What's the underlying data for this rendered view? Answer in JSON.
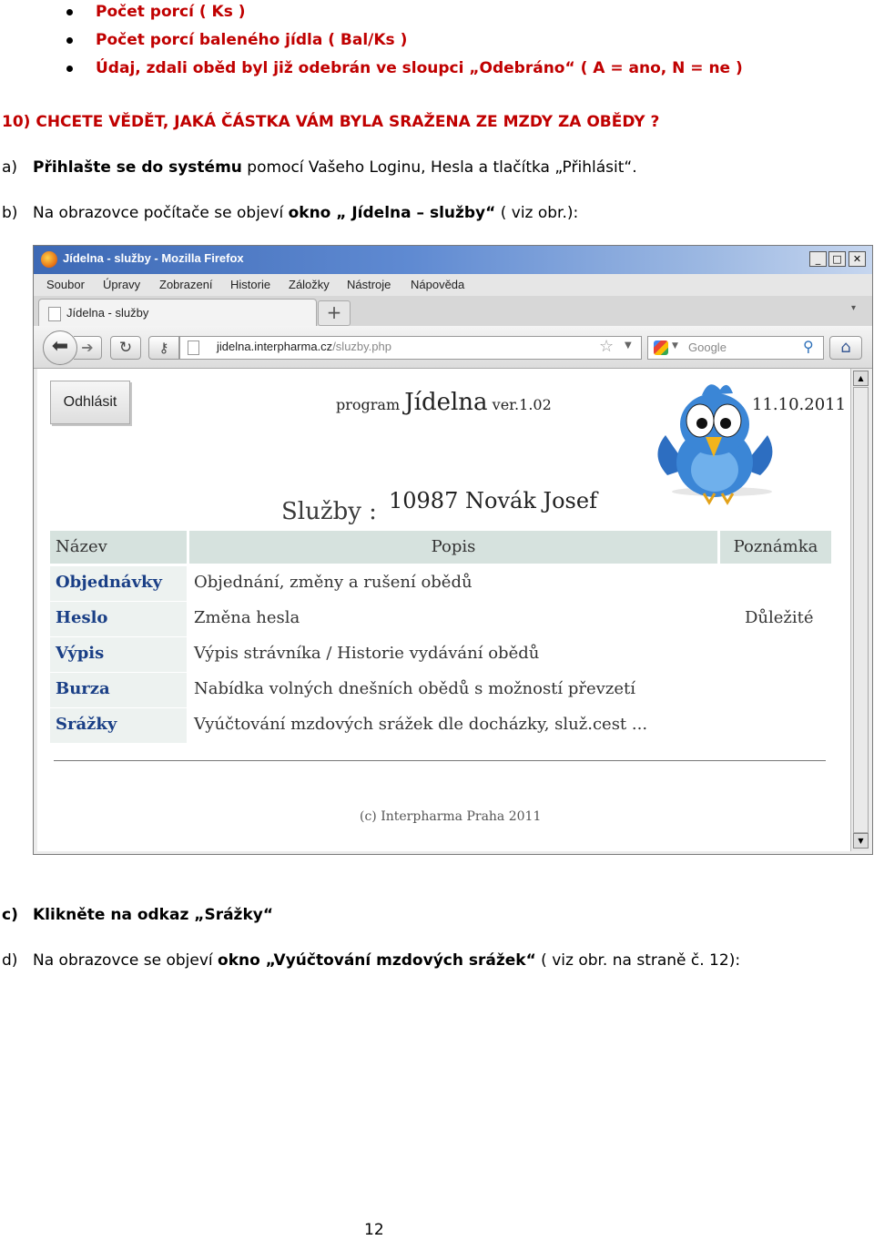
{
  "bullets": [
    "Počet porcí ( Ks )",
    "Počet porcí baleného jídla ( Bal/Ks )",
    "Údaj, zdali oběd byl již odebrán ve sloupci „Odebráno“  ( A = ano, N = ne )"
  ],
  "heading": "10) CHCETE VĚDĚT, JAKÁ ČÁSTKA VÁM BYLA SRAŽENA ZE MZDY ZA OBĚDY ?",
  "para_a": {
    "label": "a)",
    "bold": "Přihlašte se do systému",
    "rest": " pomocí Vašeho Loginu, Hesla a tlačítka „Přihlásit“."
  },
  "para_b": {
    "label": "b)",
    "pre": "Na obrazovce počítače se objeví ",
    "bold": "okno „ Jídelna – služby“",
    "rest": " ( viz obr.):"
  },
  "browser": {
    "title": "Jídelna - služby - Mozilla Firefox",
    "menu": [
      "Soubor",
      "Úpravy",
      "Zobrazení",
      "Historie",
      "Záložky",
      "Nástroje",
      "Nápověda"
    ],
    "tab_title": "Jídelna - služby",
    "url_domain": "jidelna.interpharma.cz",
    "url_path": "/sluzby.php",
    "search_placeholder": "Google",
    "page": {
      "logout": "Odhlásit",
      "program_prefix": "program",
      "program_name": "Jídelna",
      "program_version": "ver.1.02",
      "date": "11.10.2011",
      "services_label": "Služby :",
      "user_id": "10987",
      "user_name": "Novák Josef",
      "columns": [
        "Název",
        "Popis",
        "Poznámka"
      ],
      "rows": [
        {
          "name": "Objednávky",
          "desc": "Objednání, změny a rušení obědů",
          "note": ""
        },
        {
          "name": "Heslo",
          "desc": "Změna hesla",
          "note": "Důležité"
        },
        {
          "name": "Výpis",
          "desc": "Výpis strávníka / Historie vydávání obědů",
          "note": ""
        },
        {
          "name": "Burza",
          "desc": "Nabídka volných dnešních obědů s možností převzetí",
          "note": ""
        },
        {
          "name": "Srážky",
          "desc": "Vyúčtování mzdových srážek dle docházky, služ.cest ...",
          "note": ""
        }
      ],
      "footer": "(c) Interpharma Praha 2011"
    }
  },
  "para_c": {
    "label": "c)",
    "bold": "Klikněte na odkaz „Srážky“"
  },
  "para_d": {
    "label": "d)",
    "pre": "Na obrazovce se objeví ",
    "bold": "okno „Vyúčtování mzdových srážek“",
    "rest": " ( viz obr. na straně č. 12):"
  },
  "page_number": "12",
  "colors": {
    "accent_red": "#c00000",
    "link_blue": "#1a3f86",
    "table_header": "#d6e2de"
  }
}
